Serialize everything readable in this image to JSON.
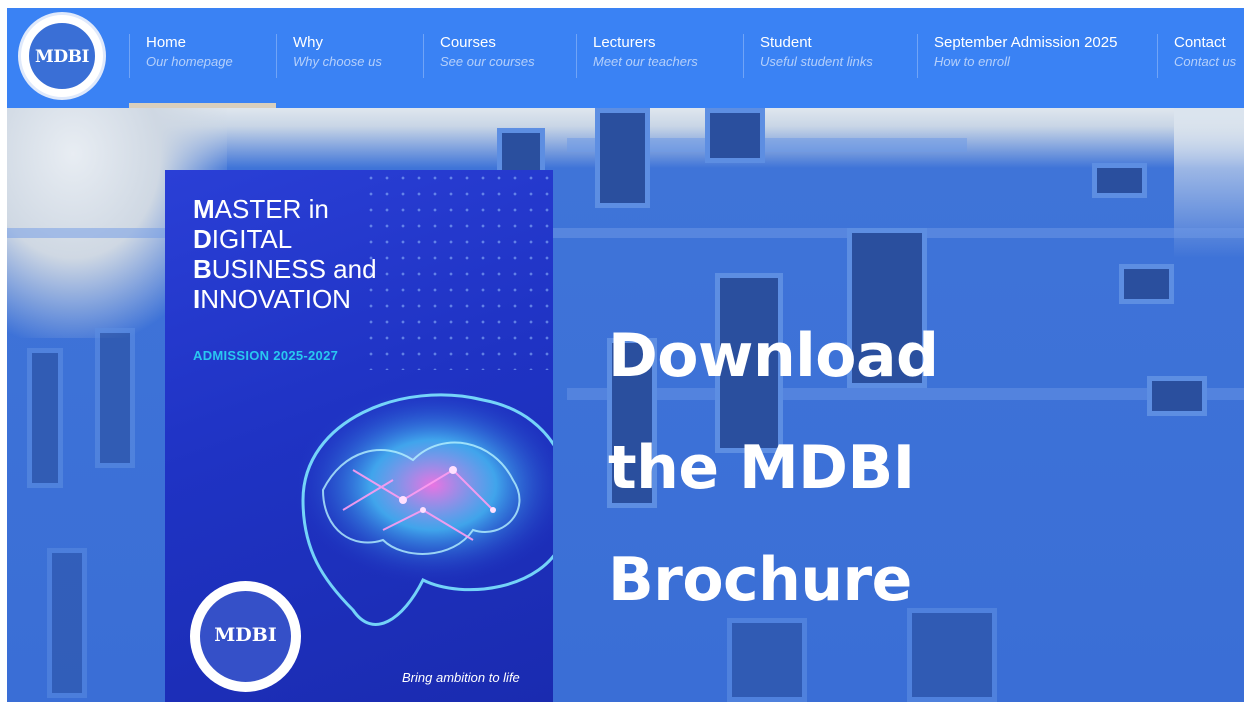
{
  "logo": {
    "text": "MDBI"
  },
  "nav": {
    "items": [
      {
        "title": "Home",
        "subtitle": "Our homepage"
      },
      {
        "title": "Why",
        "subtitle": "Why choose us"
      },
      {
        "title": "Courses",
        "subtitle": "See our courses"
      },
      {
        "title": "Lecturers",
        "subtitle": "Meet our teachers"
      },
      {
        "title": "Student",
        "subtitle": "Useful student links"
      },
      {
        "title": "September Admission 2025",
        "subtitle": "How to enroll"
      },
      {
        "title": "Contact",
        "subtitle": "Contact us"
      }
    ],
    "active_index": 0
  },
  "brochure": {
    "title_lines": [
      {
        "initial": "M",
        "rest": "ASTER in"
      },
      {
        "initial": "D",
        "rest": "IGITAL"
      },
      {
        "initial": "B",
        "rest": "USINESS and"
      },
      {
        "initial": "I",
        "rest": "NNOVATION"
      }
    ],
    "admission": "ADMISSION 2025-2027",
    "seal_text": "MDBI",
    "tagline": "Bring ambition to life"
  },
  "hero": {
    "headline_lines": [
      "Download",
      "the MDBI",
      "Brochure"
    ]
  },
  "colors": {
    "nav_bg": "#3a82f4",
    "active_indicator": "#d9cfbd",
    "admission_text": "#29c8f0"
  }
}
